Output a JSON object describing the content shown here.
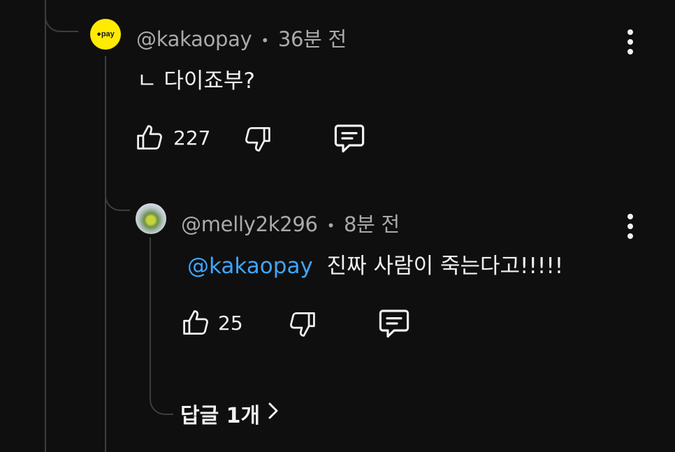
{
  "comment1": {
    "handle": "@kakaopay",
    "separator": "•",
    "time": "36분 전",
    "text": "ㄴ 다이죠부?",
    "likes": "227",
    "avatar_label": "●pay",
    "avatar_color": "#ffeb00"
  },
  "comment2": {
    "handle": "@melly2k296",
    "separator": "•",
    "time": "8분 전",
    "mention": "@kakaopay",
    "text": "진짜 사람이 죽는다고!!!!!",
    "likes": "25"
  },
  "replies_link": {
    "label": "답글 1개",
    "chevron": "›"
  },
  "icons": [
    "like-icon",
    "dislike-icon",
    "reply-icon",
    "more-options-icon",
    "chevron-right-icon"
  ],
  "colors": {
    "background": "#0f0f0f",
    "mention": "#3ea6ff",
    "meta_text": "#aaaaaa",
    "thread_line": "#3d3d3d"
  }
}
